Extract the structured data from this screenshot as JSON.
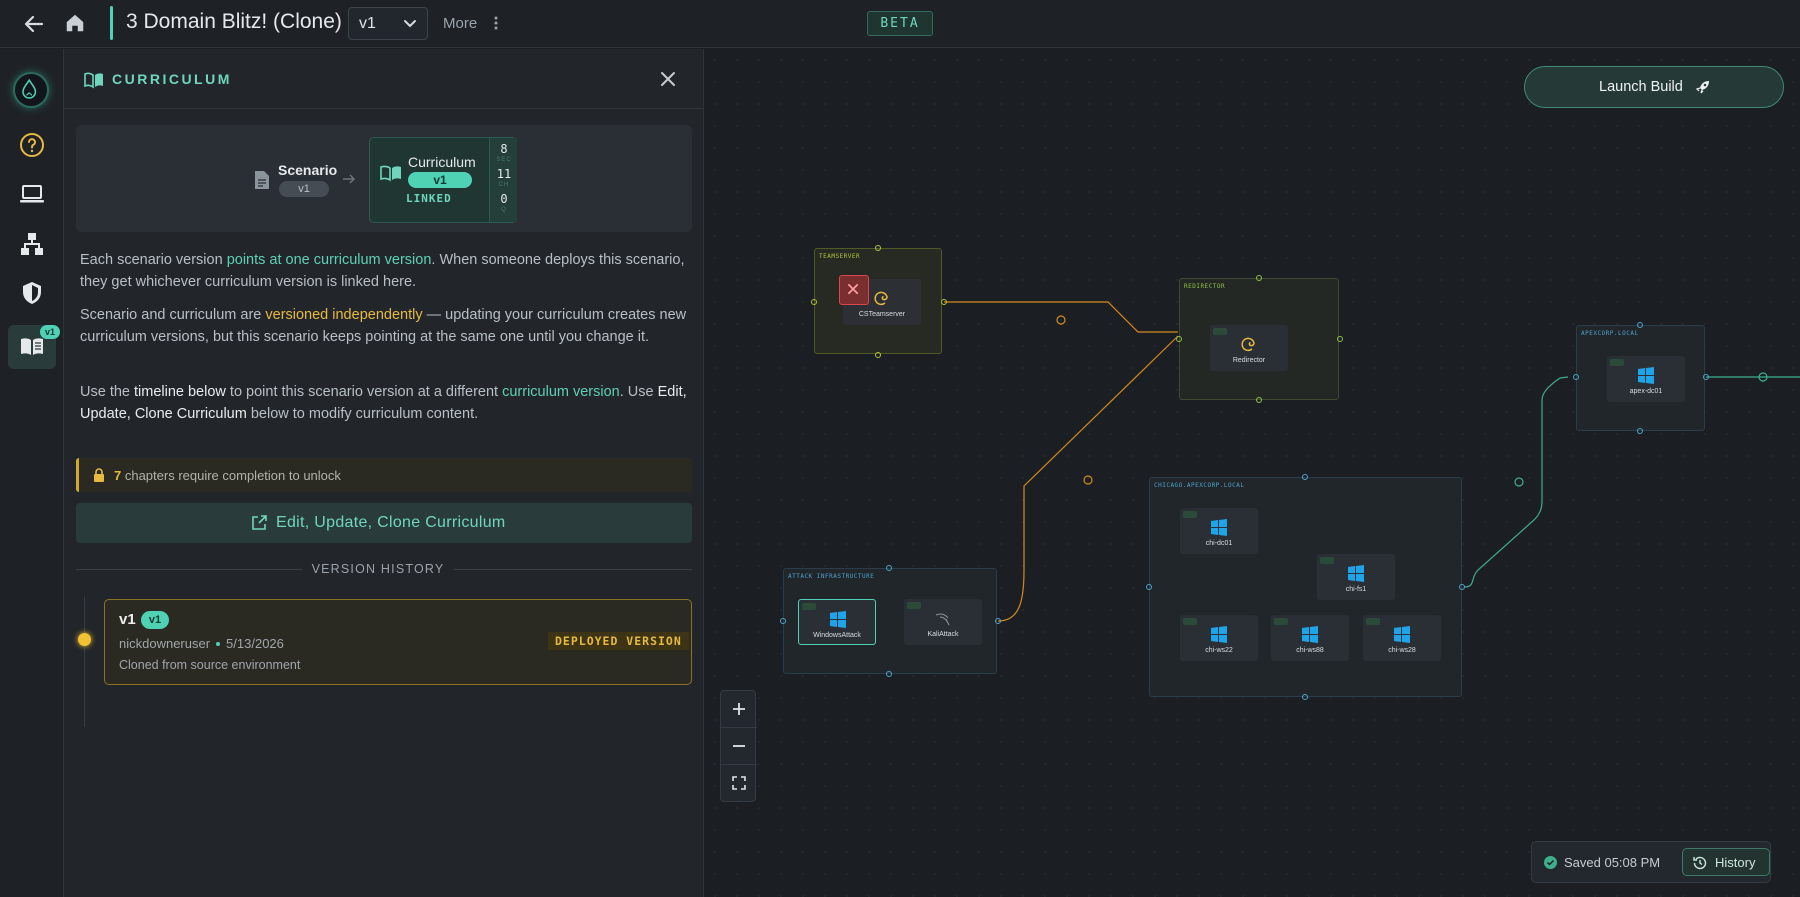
{
  "header": {
    "title": "3 Domain Blitz! (Clone)",
    "version_selected": "v1",
    "more_label": "More",
    "beta_label": "BETA"
  },
  "rail": {
    "curriculum_badge": "v1"
  },
  "panel": {
    "title": "CURRICULUM",
    "link": {
      "scenario_label": "Scenario",
      "scenario_version": "v1",
      "curriculum_label": "Curriculum",
      "curriculum_version": "v1",
      "linked_label": "LINKED",
      "stats": [
        {
          "value": "8",
          "label": "SEC"
        },
        {
          "value": "11",
          "label": "CH"
        },
        {
          "value": "0",
          "label": "Q"
        }
      ]
    },
    "p1": {
      "a": "Each scenario version ",
      "b": "points at one curriculum version",
      "c": ". When someone deploys this scenario, they get whichever curriculum version is linked here."
    },
    "p2": {
      "a": "Scenario and curriculum are ",
      "b": "versioned independently",
      "c": " — updating your curriculum creates new curriculum versions, but this scenario keeps pointing at the same one until you change it."
    },
    "p3": {
      "a": "Use the ",
      "b": "timeline below",
      "c": " to point this scenario version at a different ",
      "d": "curriculum version",
      "e": ". Use ",
      "f": "Edit, Update, Clone Curriculum",
      "g": " below to modify curriculum content."
    },
    "lock": {
      "count": "7",
      "text": " chapters require completion to unlock"
    },
    "edit_button": "Edit, Update, Clone Curriculum",
    "version_history_title": "VERSION HISTORY",
    "versions": [
      {
        "name": "v1",
        "pill": "v1",
        "user": "nickdowneruser",
        "date": "5/13/2026",
        "description": "Cloned from source environment",
        "status": "DEPLOYED VERSION"
      }
    ]
  },
  "canvas": {
    "launch_label": "Launch Build",
    "saved_text": "Saved 05:08 PM",
    "history_label": "History",
    "groups": {
      "teamserver": "TEAMSERVER",
      "redirector": "REDIRECTOR",
      "attack": "ATTACK INFRASTRUCTURE",
      "chicago": "CHICAGO.APEXCORP.LOCAL",
      "apexcorp": "APEXCORP.LOCAL"
    },
    "hosts": {
      "csteamserver": "CSTeamserver",
      "redirector": "Redirector",
      "windowsattack": "WindowsAttack",
      "kaliattack": "KaliAttack",
      "chi_dc01": "chi-dc01",
      "chi_fs1": "chi-fs1",
      "chi_ws22": "chi-ws22",
      "chi_ws88": "chi-ws88",
      "chi_ws28": "chi-ws28",
      "apex_dc01": "apex-dc01"
    }
  },
  "colors": {
    "accent": "#4fd1b4",
    "warning": "#e7b93f",
    "orange_link": "#d68a1c",
    "green_link": "#3fae8c"
  }
}
